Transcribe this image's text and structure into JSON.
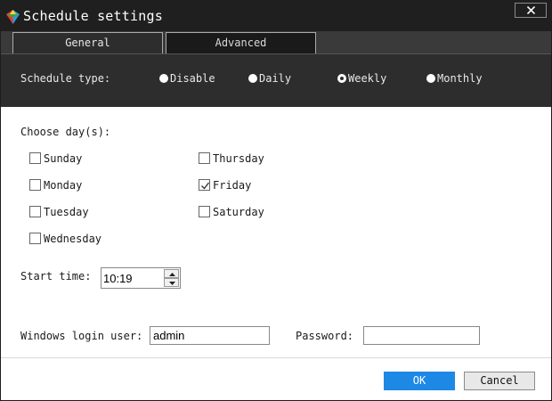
{
  "window": {
    "title": "Schedule settings",
    "close_glyph": "✕",
    "app_icon": "gem-icon"
  },
  "tabs": [
    {
      "label": "General",
      "selected": true
    },
    {
      "label": "Advanced",
      "selected": false
    }
  ],
  "schedule_type": {
    "label": "Schedule type:",
    "options": [
      {
        "label": "Disable",
        "selected": false
      },
      {
        "label": "Daily",
        "selected": false
      },
      {
        "label": "Weekly",
        "selected": true
      },
      {
        "label": "Monthly",
        "selected": false
      }
    ]
  },
  "days": {
    "label": "Choose day(s):",
    "items": [
      {
        "label": "Sunday",
        "checked": false
      },
      {
        "label": "Monday",
        "checked": false
      },
      {
        "label": "Tuesday",
        "checked": false
      },
      {
        "label": "Wednesday",
        "checked": false
      },
      {
        "label": "Thursday",
        "checked": false
      },
      {
        "label": "Friday",
        "checked": true
      },
      {
        "label": "Saturday",
        "checked": false
      }
    ]
  },
  "start_time": {
    "label": "Start time:",
    "value": "10:19"
  },
  "login": {
    "user_label": "Windows login user:",
    "user_value": "admin",
    "password_label": "Password:",
    "password_value": ""
  },
  "buttons": {
    "ok": "OK",
    "cancel": "Cancel"
  },
  "colors": {
    "titlebar": "#1f1f1f",
    "band": "#2d2d2d",
    "accent": "#1e88e5"
  }
}
